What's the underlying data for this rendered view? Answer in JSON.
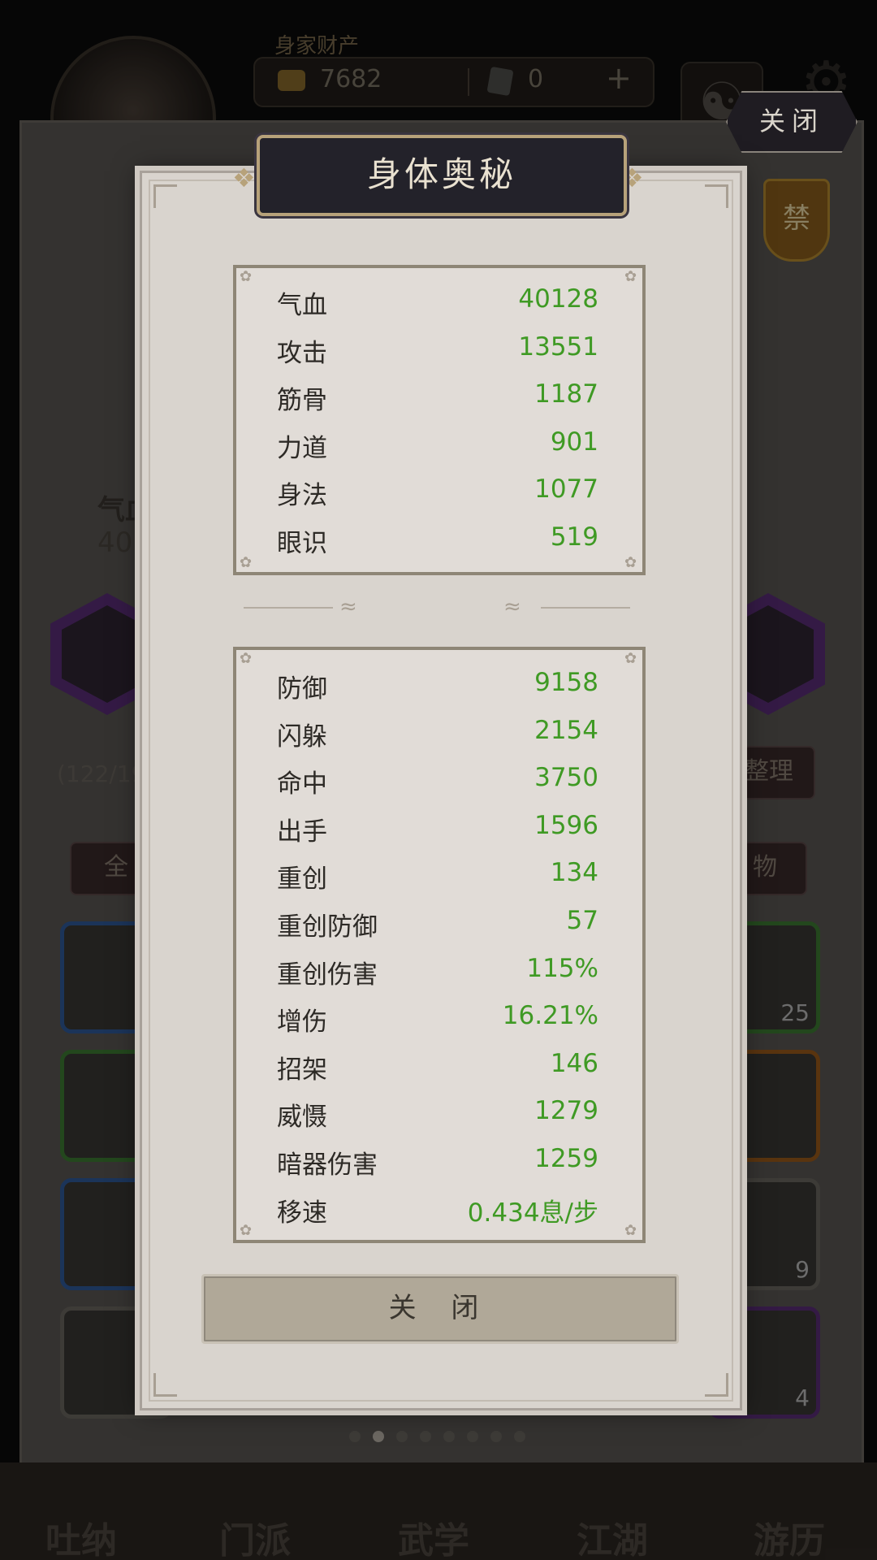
{
  "header": {
    "wealth_label": "身家财产",
    "gold": "7682",
    "tickets": "0",
    "plus": "+"
  },
  "background": {
    "partial_label_1": "气血",
    "partial_value_1": "40",
    "bag_count": "(122/19",
    "sort_label": "整理",
    "tab_all": "全",
    "tab_items": "物",
    "slot_counts": [
      "25",
      "9",
      "4"
    ],
    "forbid_badge": "禁",
    "nav": [
      "吐纳",
      "门派",
      "武学",
      "江湖",
      "游历"
    ]
  },
  "top_close_label": "关闭",
  "modal": {
    "title": "身体奥秘",
    "primary_stats": [
      {
        "label": "气血",
        "value": "40128"
      },
      {
        "label": "攻击",
        "value": "13551"
      },
      {
        "label": "筋骨",
        "value": "1187"
      },
      {
        "label": "力道",
        "value": "901"
      },
      {
        "label": "身法",
        "value": "1077"
      },
      {
        "label": "眼识",
        "value": "519"
      }
    ],
    "secondary_stats": [
      {
        "label": "防御",
        "value": "9158"
      },
      {
        "label": "闪躲",
        "value": "2154"
      },
      {
        "label": "命中",
        "value": "3750"
      },
      {
        "label": "出手",
        "value": "1596"
      },
      {
        "label": "重创",
        "value": "134"
      },
      {
        "label": "重创防御",
        "value": "57"
      },
      {
        "label": "重创伤害",
        "value": "115%"
      },
      {
        "label": "增伤",
        "value": "16.21%"
      },
      {
        "label": "招架",
        "value": "146"
      },
      {
        "label": "威慑",
        "value": "1279"
      },
      {
        "label": "暗器伤害",
        "value": "1259"
      },
      {
        "label": "移速",
        "value": "0.434息/步"
      }
    ],
    "close_label": "关 闭"
  },
  "pager": {
    "total": 8,
    "active": 1
  },
  "colors": {
    "stat_value": "#3f9a24",
    "stat_label": "#2d2a26",
    "panel": "#d9d4ce",
    "border": "#8e8676"
  }
}
